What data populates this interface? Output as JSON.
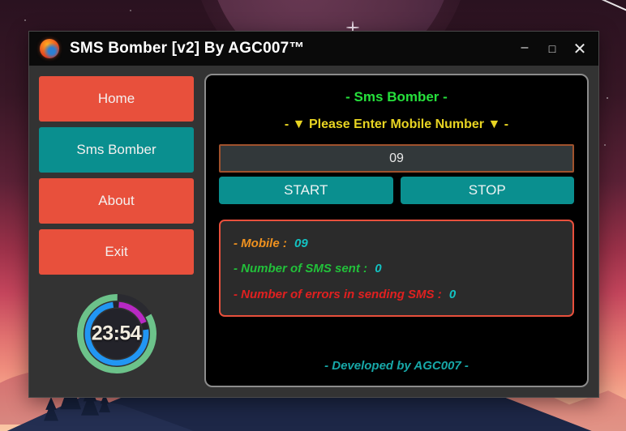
{
  "window": {
    "title": "SMS Bomber [v2] By AGC007™",
    "icon": "firefox-globe-icon",
    "controls": {
      "minimize": "–",
      "maximize": "□",
      "close": "✕"
    }
  },
  "sidebar": {
    "items": [
      {
        "label": "Home",
        "active": false
      },
      {
        "label": "Sms Bomber",
        "active": true
      },
      {
        "label": "About",
        "active": false
      },
      {
        "label": "Exit",
        "active": false
      }
    ],
    "timer": {
      "value": "23:54",
      "outer_ring_color": "#6cc28a",
      "inner_ring_color": "#2196f3",
      "accent_color": "#b829c4",
      "track_color": "#2a2a30"
    }
  },
  "main": {
    "title": "- Sms Bomber -",
    "subtitle": "-  ▼ Please Enter Mobile Number ▼  -",
    "input": {
      "value": "09",
      "placeholder": "09"
    },
    "start_label": "START",
    "stop_label": "STOP",
    "status": {
      "mobile_label": "- Mobile :",
      "mobile_value": "09",
      "sent_label": "- Number of SMS sent :",
      "sent_value": "0",
      "errors_label": "- Number of errors in sending SMS :",
      "errors_value": "0"
    },
    "footer": "- Developed by AGC007 -"
  },
  "colors": {
    "nav_default": "#e8503c",
    "nav_active": "#0a8f8f",
    "title_green": "#26e03c",
    "subtitle_yellow": "#e8d422",
    "value_cyan": "#13c2c2",
    "status_orange": "#f0921f",
    "status_green": "#22c03a",
    "status_red": "#e02020",
    "footer_teal": "#17a8a8"
  }
}
